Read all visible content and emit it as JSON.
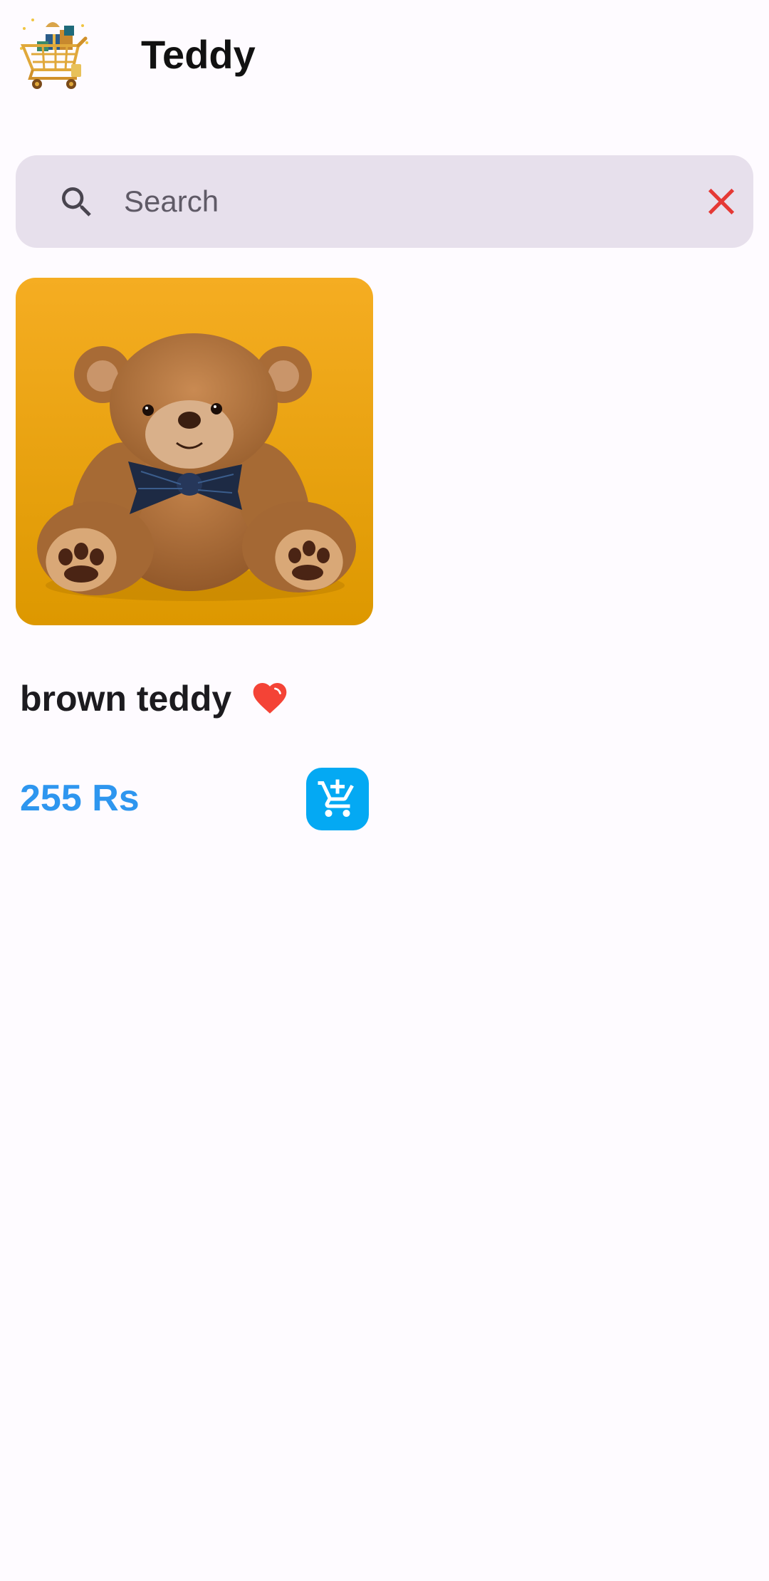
{
  "app_bar": {
    "title": "Teddy",
    "logo_icon": "shopping-cart-gifts-logo"
  },
  "search": {
    "placeholder": "Search",
    "value": "",
    "search_icon": "search-icon",
    "clear_icon": "close-icon",
    "clear_color": "#e53935"
  },
  "products": [
    {
      "name": "brown teddy",
      "price": "255 Rs",
      "favorite": true,
      "favorite_icon": "heart-icon",
      "cart_icon": "add-shopping-cart-icon"
    }
  ],
  "colors": {
    "background": "#fefbff",
    "search_bar": "#e7e0ec",
    "price": "#2e96ef",
    "cart_button": "#04a9f3",
    "heart": "#f44336"
  }
}
